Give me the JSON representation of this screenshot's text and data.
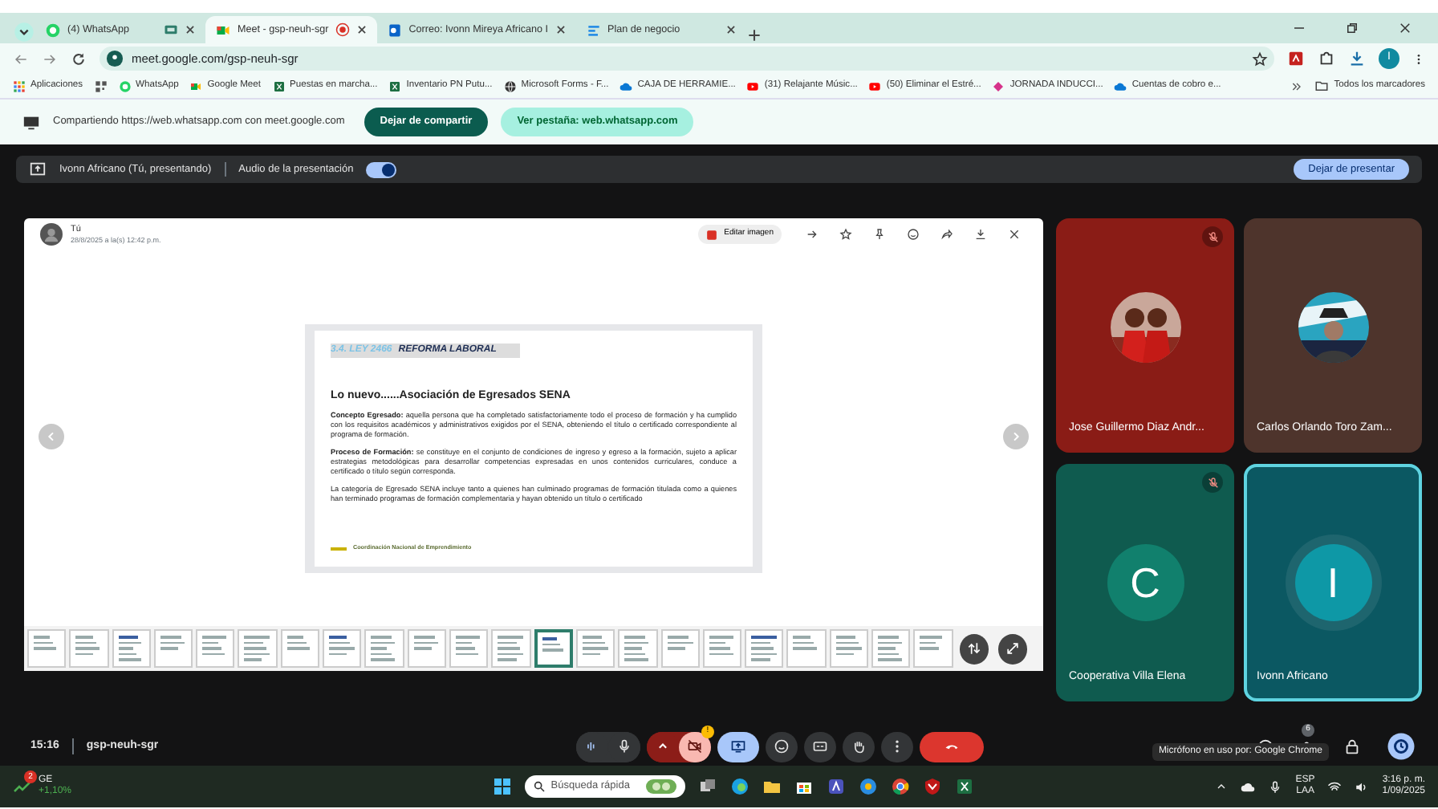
{
  "browser": {
    "tabs": [
      {
        "label": "(4) WhatsApp",
        "kind": "whatsapp",
        "selected": false,
        "media_playing": true,
        "recording": false
      },
      {
        "label": "Meet - gsp-neuh-sgr",
        "kind": "meet",
        "selected": true,
        "media_playing": false,
        "recording": true
      },
      {
        "label": "Correo: Ivonn Mireya Africano I",
        "kind": "outlook",
        "selected": false,
        "media_playing": false,
        "recording": false
      },
      {
        "label": "Plan de negocio",
        "kind": "doc",
        "selected": false,
        "media_playing": false,
        "recording": false
      }
    ],
    "address": "meet.google.com/gsp-neuh-sgr",
    "profile_initial": "I",
    "bookmarks": [
      {
        "label": "Aplicaciones",
        "kind": "apps"
      },
      {
        "label": "WhatsApp",
        "kind": "whatsapp"
      },
      {
        "label": "Google Meet",
        "kind": "meet"
      },
      {
        "label": "Puestas en marcha...",
        "kind": "excel"
      },
      {
        "label": "Inventario PN Putu...",
        "kind": "excel"
      },
      {
        "label": "Microsoft Forms - F...",
        "kind": "globe"
      },
      {
        "label": "CAJA DE HERRAMIE...",
        "kind": "cloud"
      },
      {
        "label": "(31) Relajante Músic...",
        "kind": "youtube"
      },
      {
        "label": "(50) Eliminar el Estré...",
        "kind": "youtube"
      },
      {
        "label": "JORNADA INDUCCI...",
        "kind": "diamond"
      },
      {
        "label": "Cuentas de cobro e...",
        "kind": "cloud"
      }
    ],
    "all_bookmarks": "Todos los marcadores"
  },
  "share_bar": {
    "text": "Compartiendo https://web.whatsapp.com con meet.google.com",
    "stop_button": "Dejar de compartir",
    "view_button": "Ver pestaña: web.whatsapp.com"
  },
  "presenting_bar": {
    "presenter": "Ivonn Africano (Tú, presentando)",
    "audio_label": "Audio de la presentación",
    "audio_on": true,
    "stop_button": "Dejar de presentar"
  },
  "viewer": {
    "sender": "Tú",
    "date": "28/8/2025 a la(s) 12:42 p.m.",
    "edit_button": "Editar imagen",
    "slide": {
      "number": "3.4. LEY 2466",
      "heading": "REFORMA LABORAL",
      "title": "Lo nuevo......Asociación de Egresados SENA",
      "paragraphs": [
        "**Concepto Egresado:** aquella persona que ha completado satisfactoriamente todo el proceso de formación y ha cumplido con los requisitos académicos y administrativos exigidos por el SENA, obteniendo el título o certificado correspondiente al programa de formación.",
        "**Proceso de Formación:** se constituye en el conjunto de condiciones de ingreso y egreso a la formación, sujeto a aplicar estrategias metodológicas para desarrollar competencias expresadas en unos contenidos curriculares, conduce a certificado o título según corresponda.",
        "La categoría de Egresado SENA incluye tanto a quienes han culminado programas de formación titulada como a quienes han terminado programas de formación complementaria y hayan obtenido un título o certificado"
      ],
      "footer": "Coordinación Nacional de Emprendimiento"
    },
    "thumbnails": [
      {
        "selected": false
      },
      {
        "selected": false
      },
      {
        "selected": false
      },
      {
        "selected": false
      },
      {
        "selected": false
      },
      {
        "selected": false
      },
      {
        "selected": false
      },
      {
        "selected": false
      },
      {
        "selected": false
      },
      {
        "selected": false
      },
      {
        "selected": false
      },
      {
        "selected": false
      },
      {
        "selected": true
      },
      {
        "selected": false
      },
      {
        "selected": false
      },
      {
        "selected": false
      },
      {
        "selected": false
      },
      {
        "selected": false
      },
      {
        "selected": false
      },
      {
        "selected": false
      },
      {
        "selected": false
      },
      {
        "selected": false
      }
    ]
  },
  "tiles": [
    {
      "name": "Jose Guillermo Diaz Andr...",
      "color": "#8a1c16",
      "muted": true,
      "highlighted": false
    },
    {
      "name": "Carlos Orlando Toro Zam...",
      "color": "#4e342c",
      "muted": false,
      "highlighted": false
    },
    {
      "name": "Cooperativa Villa Elena",
      "kind": "initial",
      "initial": "C",
      "color": "#0f5b4f",
      "muted": true,
      "highlighted": false
    },
    {
      "name": "Ivonn Africano",
      "kind": "initial",
      "initial": "I",
      "color": "#0b5862",
      "muted": false,
      "highlighted": true
    }
  ],
  "call_bar": {
    "time": "15:16",
    "code": "gsp-neuh-sgr",
    "controls": [
      {
        "kind": "levels"
      },
      {
        "kind": "mic",
        "on": true
      },
      {
        "kind": "caret"
      },
      {
        "kind": "camera",
        "on": false,
        "badge": "!"
      },
      {
        "kind": "present",
        "active": true
      },
      {
        "kind": "emoji"
      },
      {
        "kind": "captions"
      },
      {
        "kind": "hand"
      },
      {
        "kind": "more"
      },
      {
        "kind": "hangup"
      }
    ],
    "people_count": "6",
    "tooltip": "Micrófono en uso por: Google Chrome"
  },
  "taskbar": {
    "weather_badge": "2",
    "weather_label": "GE",
    "weather_change": "+1,10%",
    "search_placeholder": "Búsqueda rápida",
    "language": "ESP",
    "layout": "LAA",
    "time": "3:16 p. m.",
    "date": "1/09/2025"
  }
}
